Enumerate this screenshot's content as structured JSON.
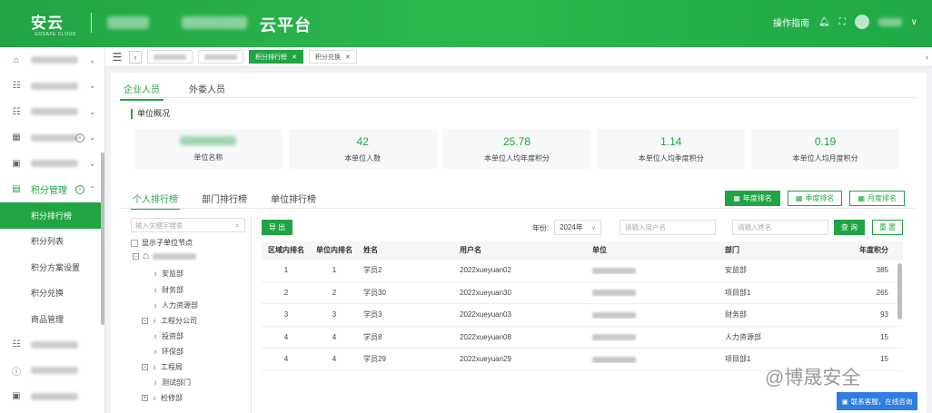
{
  "header": {
    "logo_text": "安云",
    "logo_sub": "GOSAFE CLOUD",
    "title": "云平台",
    "guide": "操作指南"
  },
  "sidebar": {
    "points_group": "积分管理",
    "sub_items": [
      "积分排行榜",
      "积分列表",
      "积分方案设置",
      "积分兑换",
      "商品管理"
    ]
  },
  "tabbar": {
    "tabs": [
      {
        "label": "积分排行榜",
        "active": true
      },
      {
        "label": "积分兑换",
        "active": false
      }
    ]
  },
  "top_tabs": [
    "企业人员",
    "外委人员"
  ],
  "section_title": "单位概况",
  "stats": [
    {
      "value": "42",
      "label": "本单位人数"
    },
    {
      "value": "25.78",
      "label": "本单位人均年度积分"
    },
    {
      "value": "1.14",
      "label": "本单位人均季度积分"
    },
    {
      "value": "0.19",
      "label": "本单位人均月度积分"
    }
  ],
  "stat_unit_label": "单位名称",
  "sub_tabs": [
    "个人排行榜",
    "部门排行榜",
    "单位排行榜"
  ],
  "rank_buttons": [
    "年度排名",
    "季度排名",
    "月度排名"
  ],
  "tree": {
    "search_placeholder": "输入关键字搜索",
    "show_children": "显示子单位节点",
    "nodes": [
      "安监部",
      "财务部",
      "人力资源部",
      "工程分公司",
      "投资部",
      "环保部",
      "工程局",
      "测试部门",
      "检修部"
    ]
  },
  "toolbar": {
    "export": "导 出",
    "year_label": "年份:",
    "year_value": "2024年",
    "username_placeholder": "请输入用户名",
    "name_placeholder": "请输入姓名",
    "query": "查 询",
    "reset": "重 置"
  },
  "table": {
    "headers": [
      "区域内排名",
      "单位内排名",
      "姓名",
      "用户名",
      "单位",
      "部门",
      "年度积分"
    ],
    "rows": [
      [
        "1",
        "1",
        "学员2",
        "2022xueyuan02",
        "安监部",
        "385"
      ],
      [
        "2",
        "2",
        "学员30",
        "2022xueyuan30",
        "项目部1",
        "265"
      ],
      [
        "3",
        "3",
        "学员3",
        "2022xueyuan03",
        "财务部",
        "93"
      ],
      [
        "4",
        "4",
        "学员8",
        "2022xueyuan08",
        "人力资源部",
        "15"
      ],
      [
        "4",
        "4",
        "学员29",
        "2022xueyuan29",
        "项目部1",
        "15"
      ]
    ]
  },
  "watermark": "@博晟安全",
  "contact": "联系客服，在线咨询",
  "colors": {
    "brand": "#21a444",
    "contact": "#2f7de1"
  }
}
